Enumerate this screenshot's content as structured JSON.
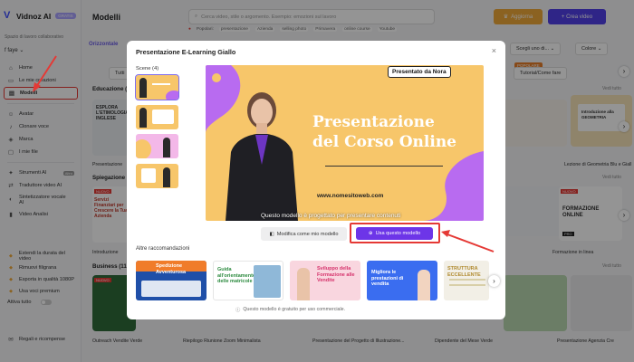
{
  "app": {
    "name": "Vidnoz AI",
    "plan_badge": "GRATIS"
  },
  "sidebar": {
    "workspace": "Spazio di lavoro collaborativo",
    "user": "f faye",
    "items_top": [
      {
        "label": "Home",
        "icon": "home-icon",
        "glyph": "⌂"
      },
      {
        "label": "Le mie creazioni",
        "icon": "folder-icon",
        "glyph": "▭"
      },
      {
        "label": "Modelli",
        "icon": "template-icon",
        "glyph": "▤",
        "active": true
      }
    ],
    "items_mid": [
      {
        "label": "Avatar",
        "icon": "avatar-icon",
        "glyph": "☺"
      },
      {
        "label": "Clonare voce",
        "icon": "voice-icon",
        "glyph": "♪"
      },
      {
        "label": "Marca",
        "icon": "brand-icon",
        "glyph": "◈"
      },
      {
        "label": "I mie file",
        "icon": "file-icon",
        "glyph": "▢"
      }
    ],
    "items_tools": [
      {
        "label": "Strumenti AI",
        "icon": "tools-icon",
        "glyph": "✦",
        "tag": "Altro"
      },
      {
        "label": "Traduttore video AI",
        "icon": "translate-icon",
        "glyph": "⇄"
      },
      {
        "label": "Sintetizzatore vocale AI",
        "icon": "tts-icon",
        "glyph": "◐"
      },
      {
        "label": "Video Analisi",
        "icon": "analytics-icon",
        "glyph": "▮"
      }
    ],
    "items_bottom": [
      {
        "label": "Estendi la durata del video",
        "icon": "extend-icon",
        "glyph": "◆"
      },
      {
        "label": "Rimuovi filigrana",
        "icon": "watermark-icon",
        "glyph": "◆"
      },
      {
        "label": "Esporta in qualità 1080P",
        "icon": "export-icon",
        "glyph": "◆"
      },
      {
        "label": "Usa voci premium",
        "icon": "premium-voice-icon",
        "glyph": "◆"
      }
    ],
    "toggle_label": "Attiva tutto",
    "footer": "Regali e ricompense"
  },
  "header": {
    "title": "Modelli",
    "search_placeholder": "Cerca video, stile o argomento. Esempio: emozioni sul lavoro",
    "upgrade_label": "Aggiorna",
    "create_label": "+ Crea video",
    "popular_label": "Popolari:",
    "popular_tags": [
      "presentazione",
      "Azienda",
      "selling photo",
      "Primavera",
      "online course",
      "Youtube"
    ]
  },
  "background": {
    "filter_label": "Orizzontale",
    "dropdown1": "Scegli uno di...",
    "dropdown2": "Colore",
    "popular_badge": "POPOLARE",
    "tab_right": "Tutorial/Come fare",
    "tab_left": "Tutti",
    "sections": [
      "Educazione (",
      "Spiegazione",
      "Business (11"
    ],
    "see_all": "Vedi tutto",
    "captions": [
      "Presentazione",
      "Introduzione",
      "Outreach Vendite Verde",
      "Riepilogo Riunione Zoom Minimalista",
      "Presentazione del Progetto di Illustrazione...",
      "Dipendente del Mese Verde",
      "Presentazione Agenzia Cre",
      "Lezione di Geometria Blu e Giall",
      "Formazione in linea"
    ],
    "card_texts": {
      "esplora": "ESPLORA L'ETIMOLOGIA INGLESE",
      "servizi": "Servizi Finanziari per Crescere la Tua Azienda",
      "geometria": "Introduzione alla GEOMETRIA",
      "formazione": "FORMAZIONE ONLINE",
      "nuovo": "NUOVO",
      "pro": "PRO"
    }
  },
  "modal": {
    "title": "Presentazione E-Learning Giallo",
    "scenes_label": "Scene (4)",
    "preview": {
      "title_line1": "Presentazione",
      "title_line2": "del Corso Online",
      "bubble": "Presentato da Nora",
      "url": "www.nomesitoweb.com",
      "caption": "Questo modello è progettato per presentare contenuti"
    },
    "edit_button": "Modifica come mio modello",
    "use_button": "Usa questo modello",
    "recommendations_label": "Altre raccomandazioni",
    "recommendations": [
      {
        "title": "Spedizione Avventurosa",
        "bg": "#1f4fa8",
        "accent": "#f07c2a"
      },
      {
        "title": "Guida all'orientamento delle matricole",
        "bg": "#ffffff",
        "accent": "#2b8a3e"
      },
      {
        "title": "Sviluppo della Formazione alle Vendite",
        "bg": "#f9d6df",
        "accent": "#d6336c"
      },
      {
        "title": "Migliora le prestazioni di vendita",
        "bg": "#3a6df0",
        "accent": "#ffffff"
      },
      {
        "title": "STRUTTURA ECCELLENTE",
        "bg": "#f2efe6",
        "accent": "#b08a2e"
      }
    ],
    "footer_note": "Questo modello è gratuito per uso commerciale."
  },
  "colors": {
    "accent": "#6d35e8",
    "highlight": "#e53935",
    "preview_bg": "#f7c66a",
    "preview_purple": "#b86bf0"
  }
}
